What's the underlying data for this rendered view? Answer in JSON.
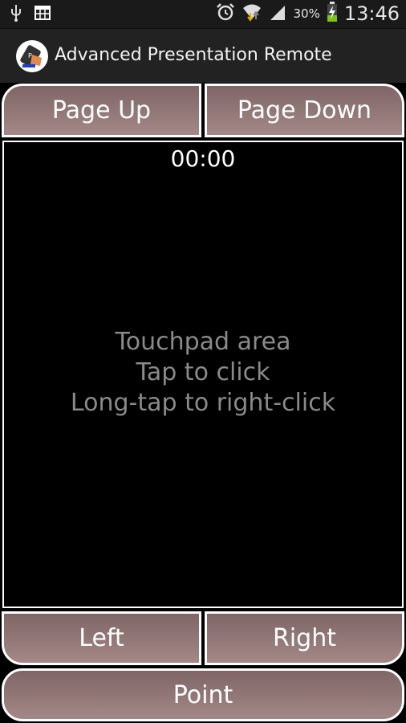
{
  "status_bar": {
    "left_icons": [
      "usb-icon",
      "calendar-grid-icon"
    ],
    "right_icons": [
      "alarm-icon",
      "wifi-icon",
      "signal-icon",
      "battery-charging-icon"
    ],
    "battery": "30%",
    "time": "13:46"
  },
  "action_bar": {
    "title": "Advanced Presentation Remote",
    "icon": "app-logo-icon"
  },
  "buttons": {
    "page_up": "Page Up",
    "page_down": "Page Down",
    "left": "Left",
    "right": "Right",
    "point": "Point"
  },
  "touchpad": {
    "timer": "00:00",
    "line1": "Touchpad area",
    "line2": "Tap to click",
    "line3": "Long-tap to right-click"
  },
  "colors": {
    "button_top": "#7f6565",
    "button_bottom": "#a48888",
    "touchpad_text": "#8a8a8a"
  }
}
